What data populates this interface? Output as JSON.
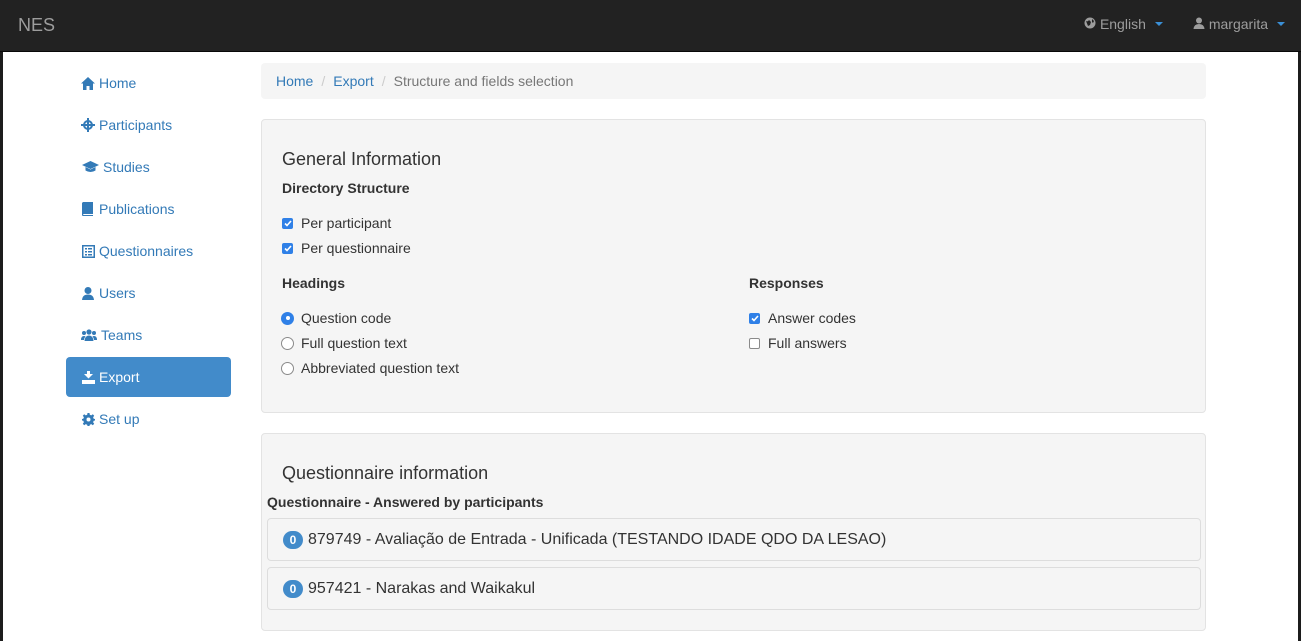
{
  "navbar": {
    "brand": "NES",
    "language": "English",
    "user": "margarita"
  },
  "sidebar": {
    "items": [
      {
        "label": "Home",
        "icon": "home-icon"
      },
      {
        "label": "Participants",
        "icon": "crosshair-icon"
      },
      {
        "label": "Studies",
        "icon": "graduation-cap-icon"
      },
      {
        "label": "Publications",
        "icon": "book-icon"
      },
      {
        "label": "Questionnaires",
        "icon": "list-alt-icon"
      },
      {
        "label": "Users",
        "icon": "user-icon"
      },
      {
        "label": "Teams",
        "icon": "users-icon"
      },
      {
        "label": "Export",
        "icon": "export-icon",
        "active": true
      },
      {
        "label": "Set up",
        "icon": "cog-icon"
      }
    ]
  },
  "breadcrumb": {
    "items": [
      "Home",
      "Export",
      "Structure and fields selection"
    ]
  },
  "general": {
    "title": "General Information",
    "directory_title": "Directory Structure",
    "directory_options": [
      {
        "label": "Per participant",
        "checked": true
      },
      {
        "label": "Per questionnaire",
        "checked": true
      }
    ],
    "headings_title": "Headings",
    "headings_options": [
      {
        "label": "Question code",
        "selected": true
      },
      {
        "label": "Full question text",
        "selected": false
      },
      {
        "label": "Abbreviated question text",
        "selected": false
      }
    ],
    "responses_title": "Responses",
    "responses_options": [
      {
        "label": "Answer codes",
        "checked": true
      },
      {
        "label": "Full answers",
        "checked": false
      }
    ]
  },
  "questionnaire": {
    "title": "Questionnaire information",
    "subtitle": "Questionnaire - Answered by participants",
    "items": [
      {
        "count": "0",
        "label": "879749 - Avaliação de Entrada - Unificada (TESTANDO IDADE QDO DA LESAO)"
      },
      {
        "count": "0",
        "label": "957421 - Narakas and Waikakul"
      }
    ]
  },
  "colors": {
    "navbar_bg": "#222222",
    "link": "#337ab7",
    "active_bg": "#428bca",
    "check": "#2f80e7"
  }
}
